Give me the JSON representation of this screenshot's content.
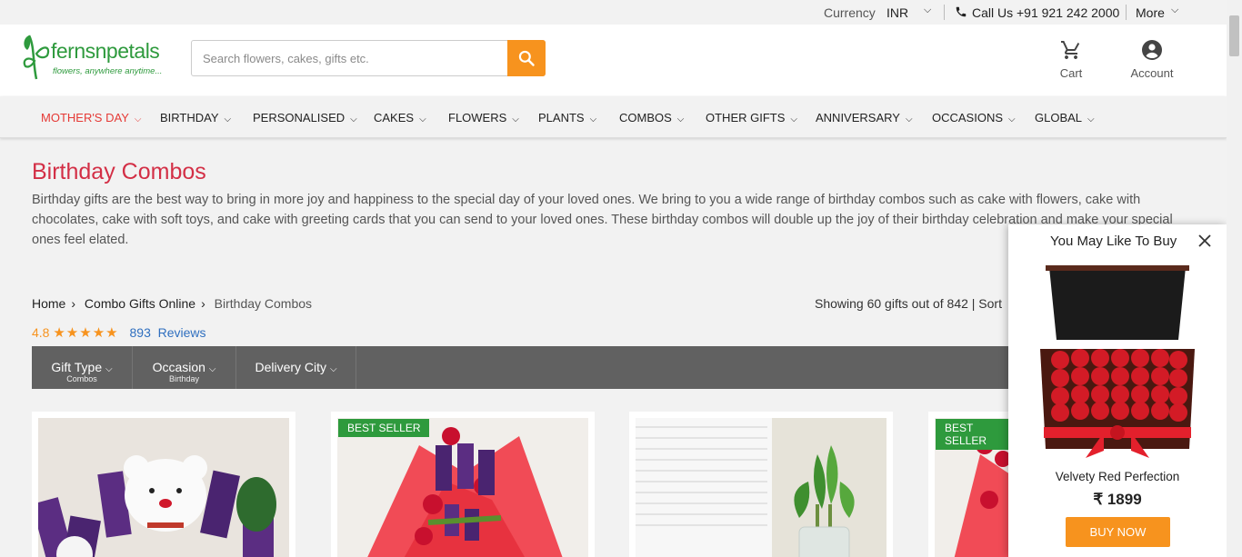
{
  "topbar": {
    "currency_label": "Currency",
    "currency_value": "INR",
    "call_label": "Call Us +91 921 242 2000",
    "more_label": "More"
  },
  "header": {
    "logo_text": "fernsnpetals",
    "logo_tagline": "flowers, anywhere anytime...",
    "search_placeholder": "Search flowers, cakes, gifts etc.",
    "cart_label": "Cart",
    "account_label": "Account"
  },
  "nav": {
    "items": [
      {
        "label": "MOTHER'S DAY"
      },
      {
        "label": "BIRTHDAY"
      },
      {
        "label": "PERSONALISED"
      },
      {
        "label": "CAKES"
      },
      {
        "label": "FLOWERS"
      },
      {
        "label": "PLANTS"
      },
      {
        "label": "COMBOS"
      },
      {
        "label": "OTHER GIFTS"
      },
      {
        "label": "ANNIVERSARY"
      },
      {
        "label": "OCCASIONS"
      },
      {
        "label": "GLOBAL"
      }
    ]
  },
  "page": {
    "title": "Birthday Combos",
    "description": "Birthday gifts are the best way to bring in more joy and happiness to the special day of your loved ones. We bring to you a wide range of birthday combos such as cake with flowers, cake with chocolates, cake with soft toys, and cake with greeting cards that you can send to your loved ones. These birthday combos will double up the joy of their birthday celebration and make your special ones feel elated.",
    "breadcrumb": [
      "Home",
      "Combo Gifts Online",
      "Birthday Combos"
    ],
    "showing": "Showing 60 gifts out of 842 |  Sort",
    "rating_value": "4.8",
    "rating_stars": "★★★★★",
    "rating_count": "893",
    "rating_reviews": "Reviews"
  },
  "filters": [
    {
      "label": "Gift Type",
      "sub": "Combos"
    },
    {
      "label": "Occasion",
      "sub": "Birthday"
    },
    {
      "label": "Delivery City",
      "sub": ""
    }
  ],
  "products": {
    "badge": "BEST SELLER"
  },
  "popup": {
    "title": "You May Like To Buy",
    "product_name": "Velvety Red Perfection",
    "price": "₹ 1899",
    "buy_label": "BUY NOW"
  },
  "colors": {
    "accent_orange": "#f7931e",
    "title_red": "#d32f46",
    "logo_green": "#2e9a3d",
    "badge_green": "#2e9a3d",
    "filter_bar": "#616161"
  }
}
